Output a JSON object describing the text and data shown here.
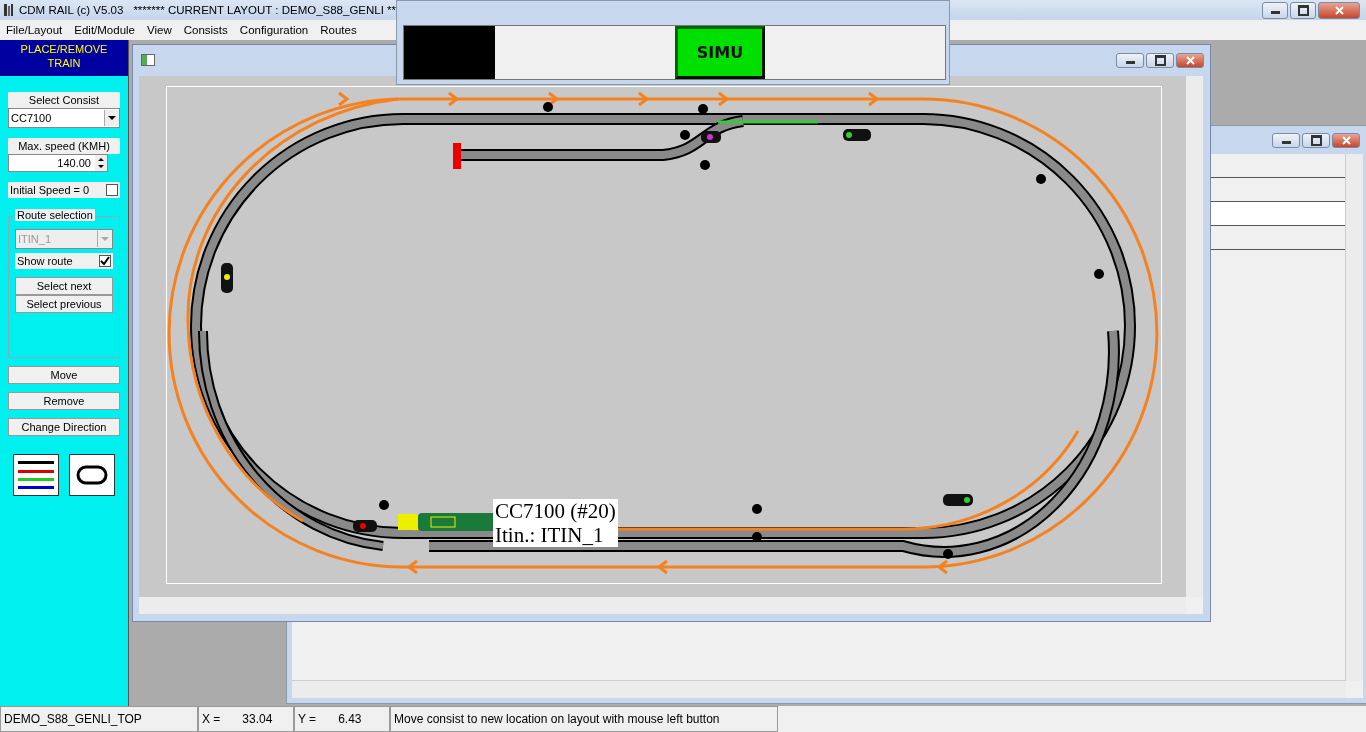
{
  "window": {
    "title": "CDM RAIL (c) V5.03",
    "layout_title": "******* CURRENT LAYOUT : DEMO_S88_GENLI **"
  },
  "menu": [
    {
      "label": "File/Layout"
    },
    {
      "label": "Edit/Module"
    },
    {
      "label": "View"
    },
    {
      "label": "Consists"
    },
    {
      "label": "Configuration"
    },
    {
      "label": "Routes"
    }
  ],
  "panel": {
    "header": "PLACE/REMOVE TRAIN",
    "select_consist": {
      "label": "Select Consist",
      "value": "CC7100"
    },
    "max_speed": {
      "label": "Max. speed (KMH)",
      "value": "140.00"
    },
    "initial_speed": {
      "label": "Initial Speed = 0",
      "checked": false
    },
    "route_selection": {
      "legend": "Route selection",
      "value": "ITIN_1",
      "disabled": true,
      "show_route": {
        "label": "Show route",
        "checked": true
      },
      "buttons": [
        "Select next",
        "Select previous"
      ]
    },
    "buttons": [
      "Move",
      "Remove",
      "Change Direction"
    ]
  },
  "sim_window": {
    "button": {
      "label": "SIMU",
      "active": true
    }
  },
  "tooltip": {
    "lines": [
      "CC7100 (#20)",
      "Itin.: ITIN_1"
    ]
  },
  "status_bar": {
    "layout": "DEMO_S88_GENLI_TOP",
    "x_label": "X =",
    "x_value": "33.04",
    "y_label": "Y =",
    "y_value": "6.43",
    "message": "Move consist to new location on layout with mouse left button"
  }
}
